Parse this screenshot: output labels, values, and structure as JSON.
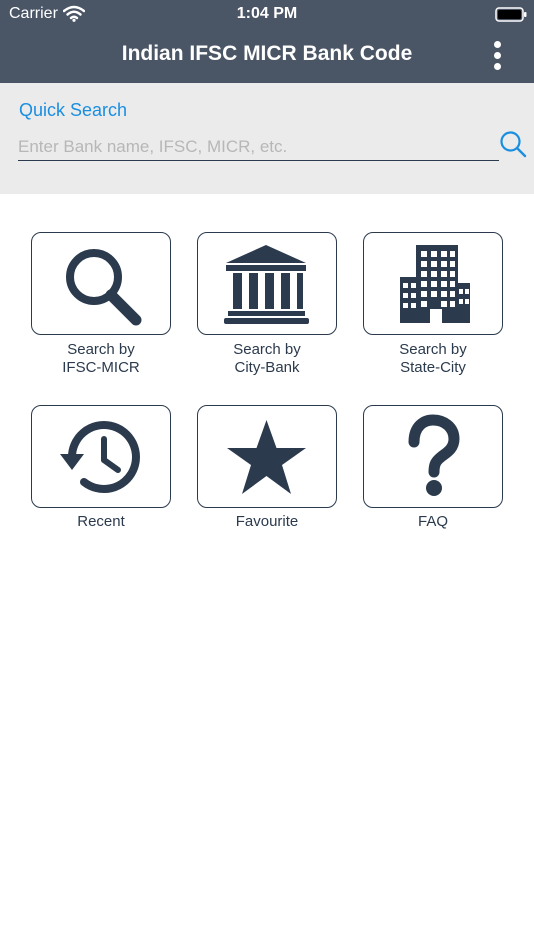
{
  "status_bar": {
    "carrier": "Carrier",
    "time": "1:04 PM"
  },
  "header": {
    "title": "Indian IFSC MICR Bank Code"
  },
  "quick_search": {
    "label": "Quick Search",
    "placeholder": "Enter Bank name, IFSC, MICR, etc.",
    "accent_color": "#1a8ee0"
  },
  "theme": {
    "header_bg": "#4a5566",
    "icon_color": "#2b3a4d",
    "panel_bg": "#ebebeb"
  },
  "menu": [
    {
      "line1": "Search by",
      "line2": "IFSC-MICR",
      "icon": "magnifier-icon"
    },
    {
      "line1": "Search by",
      "line2": "City-Bank",
      "icon": "bank-building-icon"
    },
    {
      "line1": "Search by",
      "line2": "State-City",
      "icon": "office-buildings-icon"
    },
    {
      "line1": "Recent",
      "icon": "history-icon"
    },
    {
      "line1": "Favourite",
      "icon": "star-icon"
    },
    {
      "line1": "FAQ",
      "icon": "question-mark-icon"
    }
  ]
}
